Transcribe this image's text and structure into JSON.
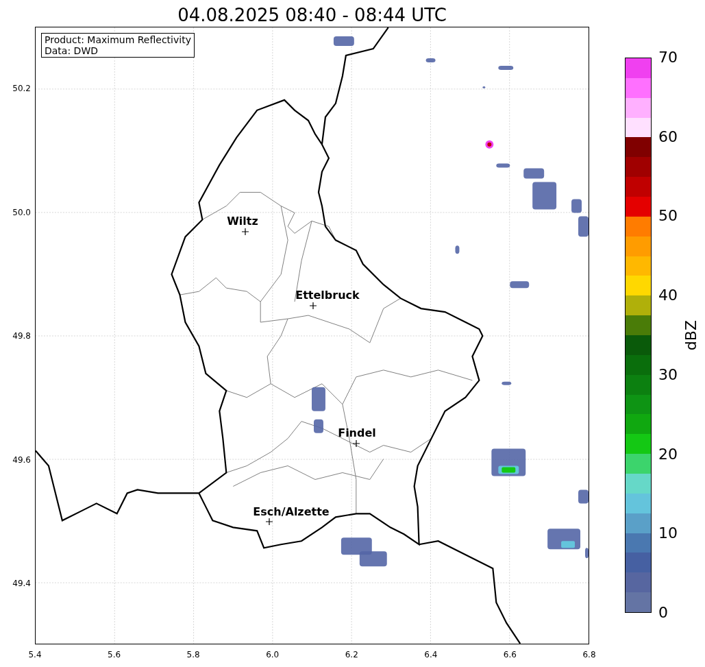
{
  "title": "04.08.2025 08:40 - 08:44 UTC",
  "info_box": [
    "Product: Maximum Reflectivity",
    "Data: DWD"
  ],
  "cities": [
    {
      "name": "Wiltz"
    },
    {
      "name": "Ettelbruck"
    },
    {
      "name": "Findel"
    },
    {
      "name": "Esch/Alzette"
    }
  ],
  "x_ticks": [
    "5.4",
    "5.6",
    "5.8",
    "6.0",
    "6.2",
    "6.4",
    "6.6",
    "6.8"
  ],
  "y_ticks": [
    "50.2",
    "50.0",
    "49.8",
    "49.6",
    "49.4"
  ],
  "colorbar": {
    "label": "dBZ",
    "ticks": [
      "70",
      "60",
      "50",
      "40",
      "30",
      "20",
      "10",
      "0"
    ],
    "segments": [
      {
        "color": "#6474a4"
      },
      {
        "color": "#5766a0"
      },
      {
        "color": "#4660a2"
      },
      {
        "color": "#4a78b0"
      },
      {
        "color": "#5aa0c8"
      },
      {
        "color": "#64c4dc"
      },
      {
        "color": "#66d8c8"
      },
      {
        "color": "#3cd46c"
      },
      {
        "color": "#14c814"
      },
      {
        "color": "#10a810"
      },
      {
        "color": "#0e9414"
      },
      {
        "color": "#0c8010"
      },
      {
        "color": "#0a6e0c"
      },
      {
        "color": "#0a5a0a"
      },
      {
        "color": "#4a7c08"
      },
      {
        "color": "#b0b00a"
      },
      {
        "color": "#ffd800"
      },
      {
        "color": "#ffb800"
      },
      {
        "color": "#ff9c00"
      },
      {
        "color": "#ff7c00"
      },
      {
        "color": "#e40000"
      },
      {
        "color": "#c00000"
      },
      {
        "color": "#a00000"
      },
      {
        "color": "#800000"
      },
      {
        "color": "#ffe0ff"
      },
      {
        "color": "#ffb0ff"
      },
      {
        "color": "#ff70ff"
      },
      {
        "color": "#f040f0"
      }
    ]
  }
}
